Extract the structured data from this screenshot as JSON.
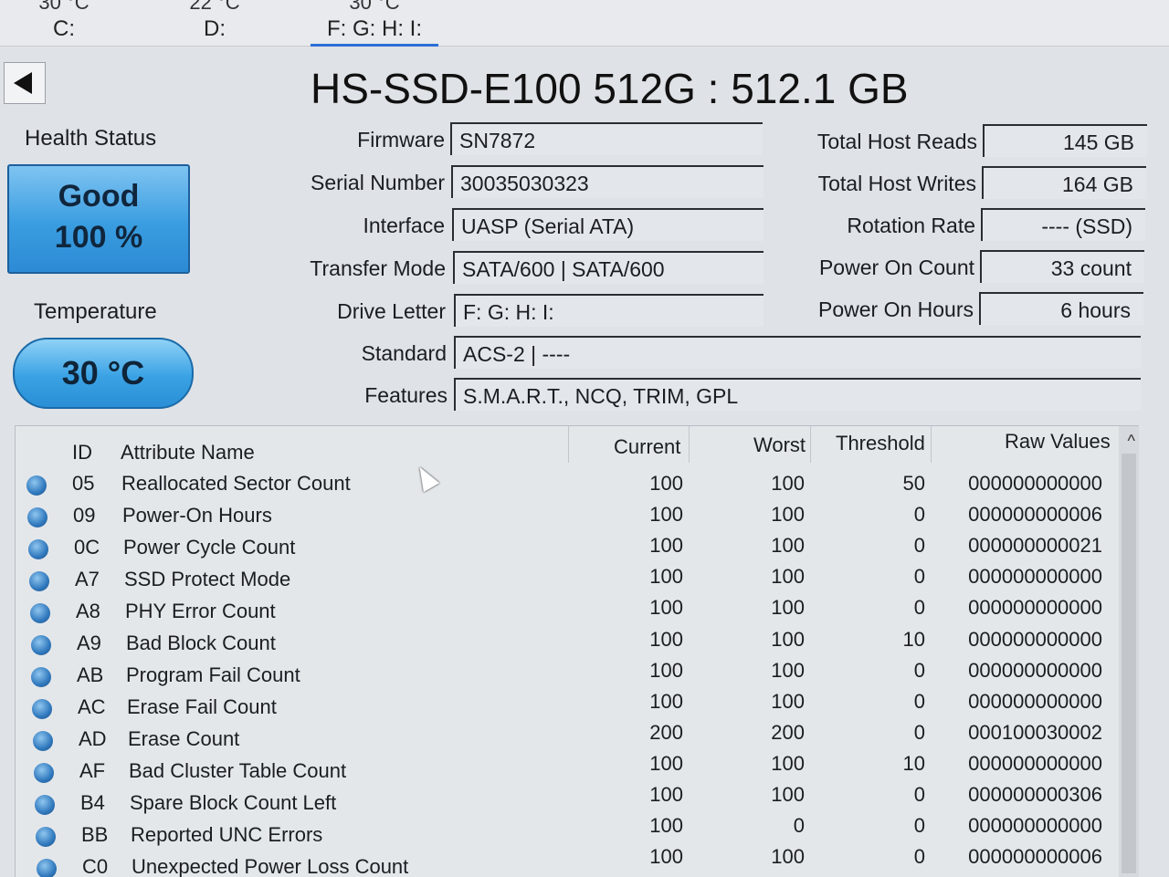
{
  "drives": [
    {
      "temp": "30 °C",
      "letter": "C:"
    },
    {
      "temp": "22 °C",
      "letter": "D:"
    },
    {
      "temp": "30 °C",
      "letter": "F: G: H: I:"
    }
  ],
  "title": "HS-SSD-E100 512G : 512.1 GB",
  "health": {
    "label": "Health Status",
    "status": "Good",
    "percent": "100 %"
  },
  "temperature": {
    "label": "Temperature",
    "value": "30 °C"
  },
  "info_left": [
    {
      "label": "Firmware",
      "value": "SN7872"
    },
    {
      "label": "Serial Number",
      "value": "30035030323"
    },
    {
      "label": "Interface",
      "value": "UASP (Serial ATA)"
    },
    {
      "label": "Transfer Mode",
      "value": "SATA/600 | SATA/600"
    },
    {
      "label": "Drive Letter",
      "value": "F: G: H: I:"
    },
    {
      "label": "Standard",
      "value": "ACS-2 | ----"
    },
    {
      "label": "Features",
      "value": "S.M.A.R.T., NCQ, TRIM, GPL"
    }
  ],
  "info_right": [
    {
      "label": "Total Host Reads",
      "value": "145 GB"
    },
    {
      "label": "Total Host Writes",
      "value": "164 GB"
    },
    {
      "label": "Rotation Rate",
      "value": "---- (SSD)"
    },
    {
      "label": "Power On Count",
      "value": "33 count"
    },
    {
      "label": "Power On Hours",
      "value": "6 hours"
    }
  ],
  "table": {
    "headers": {
      "id": "ID",
      "name": "Attribute Name",
      "current": "Current",
      "worst": "Worst",
      "threshold": "Threshold",
      "raw": "Raw Values"
    },
    "rows": [
      {
        "id": "05",
        "name": "Reallocated Sector Count",
        "current": "100",
        "worst": "100",
        "threshold": "50",
        "raw": "000000000000"
      },
      {
        "id": "09",
        "name": "Power-On Hours",
        "current": "100",
        "worst": "100",
        "threshold": "0",
        "raw": "000000000006"
      },
      {
        "id": "0C",
        "name": "Power Cycle Count",
        "current": "100",
        "worst": "100",
        "threshold": "0",
        "raw": "000000000021"
      },
      {
        "id": "A7",
        "name": "SSD Protect Mode",
        "current": "100",
        "worst": "100",
        "threshold": "0",
        "raw": "000000000000"
      },
      {
        "id": "A8",
        "name": "PHY Error Count",
        "current": "100",
        "worst": "100",
        "threshold": "0",
        "raw": "000000000000"
      },
      {
        "id": "A9",
        "name": "Bad Block Count",
        "current": "100",
        "worst": "100",
        "threshold": "10",
        "raw": "000000000000"
      },
      {
        "id": "AB",
        "name": "Program Fail Count",
        "current": "100",
        "worst": "100",
        "threshold": "0",
        "raw": "000000000000"
      },
      {
        "id": "AC",
        "name": "Erase Fail Count",
        "current": "100",
        "worst": "100",
        "threshold": "0",
        "raw": "000000000000"
      },
      {
        "id": "AD",
        "name": "Erase Count",
        "current": "200",
        "worst": "200",
        "threshold": "0",
        "raw": "000100030002"
      },
      {
        "id": "AF",
        "name": "Bad Cluster Table Count",
        "current": "100",
        "worst": "100",
        "threshold": "10",
        "raw": "000000000000"
      },
      {
        "id": "B4",
        "name": "Spare Block Count Left",
        "current": "100",
        "worst": "100",
        "threshold": "0",
        "raw": "000000000306"
      },
      {
        "id": "BB",
        "name": "Reported UNC Errors",
        "current": "100",
        "worst": "0",
        "threshold": "0",
        "raw": "000000000000"
      },
      {
        "id": "C0",
        "name": "Unexpected Power Loss Count",
        "current": "100",
        "worst": "100",
        "threshold": "0",
        "raw": "000000000006"
      }
    ]
  },
  "icons": {
    "back": "back-arrow-icon",
    "status": "status-dot-icon",
    "sort": "scroll-up-icon"
  },
  "colors": {
    "health_blue": "#3a9de0",
    "accent": "#2b6fd6"
  }
}
